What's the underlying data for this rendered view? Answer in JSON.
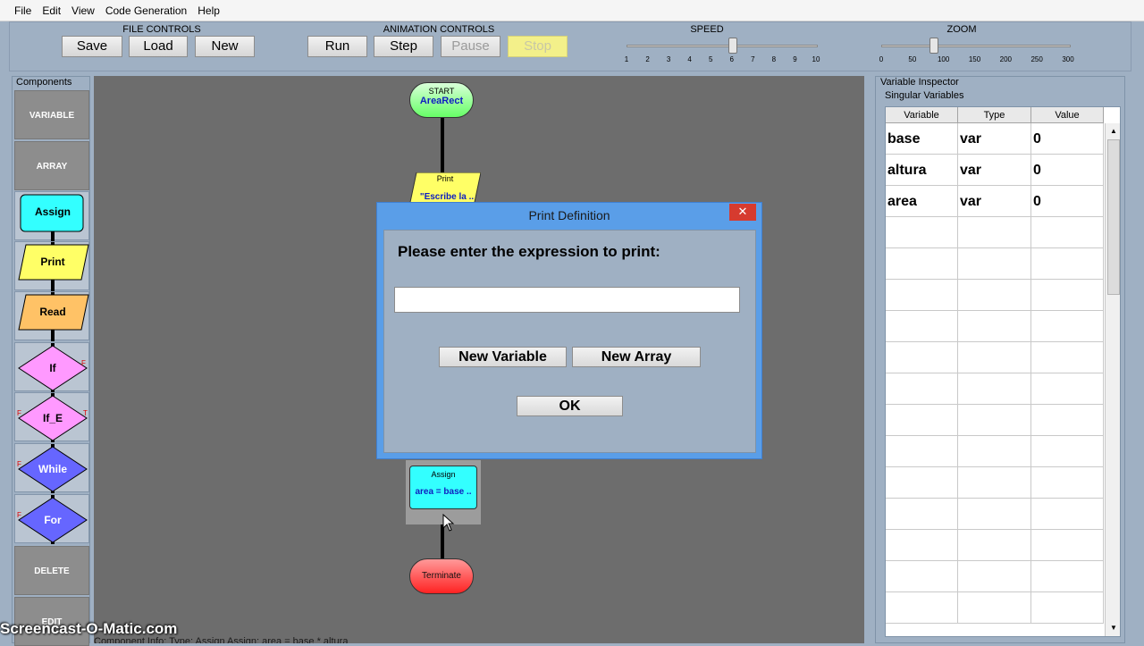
{
  "menu": [
    "File",
    "Edit",
    "View",
    "Code Generation",
    "Help"
  ],
  "file_controls": {
    "title": "FILE CONTROLS",
    "save": "Save",
    "load": "Load",
    "new": "New"
  },
  "animation_controls": {
    "title": "ANIMATION CONTROLS",
    "run": "Run",
    "step": "Step",
    "pause": "Pause",
    "stop": "Stop"
  },
  "speed": {
    "title": "SPEED",
    "ticks": [
      "1",
      "2",
      "3",
      "4",
      "5",
      "6",
      "7",
      "8",
      "9",
      "10"
    ],
    "value": 6
  },
  "zoom": {
    "title": "ZOOM",
    "ticks": [
      "0",
      "50",
      "100",
      "150",
      "200",
      "250",
      "300"
    ],
    "value": 100
  },
  "components": {
    "title": "Components",
    "variable": "VARIABLE",
    "array": "ARRAY",
    "assign": "Assign",
    "print": "Print",
    "read": "Read",
    "if": "If",
    "if_e": "If_E",
    "while": "While",
    "for": "For",
    "delete": "DELETE",
    "edit": "EDIT"
  },
  "flowchart": {
    "start_label": "START",
    "start_name": "AreaRect",
    "print_label": "Print",
    "print_value": "\"Escribe la ..",
    "assign_label": "Assign",
    "assign_value": "area = base ..",
    "terminate": "Terminate"
  },
  "inspector": {
    "title": "Variable Inspector",
    "subtitle": "Singular Variables",
    "columns": [
      "Variable",
      "Type",
      "Value"
    ],
    "rows": [
      {
        "variable": "base",
        "type": "var",
        "value": "0"
      },
      {
        "variable": "altura",
        "type": "var",
        "value": "0"
      },
      {
        "variable": "area",
        "type": "var",
        "value": "0"
      }
    ]
  },
  "dialog": {
    "title": "Print Definition",
    "close": "✕",
    "prompt": "Please enter the expression to print:",
    "input_value": "",
    "new_variable": "New Variable",
    "new_array": "New Array",
    "ok": "OK"
  },
  "status": {
    "text": "Component Info:   Type: Assign      Assign: area = base * altura"
  },
  "watermark": "Screencast-O-Matic.com",
  "colors": {
    "assign": "#33ffff",
    "print": "#ffff66",
    "read": "#ffc266",
    "if": "#ff99ff",
    "while": "#6666ff",
    "terminate": "#ff3333",
    "start": "#66ff66"
  }
}
